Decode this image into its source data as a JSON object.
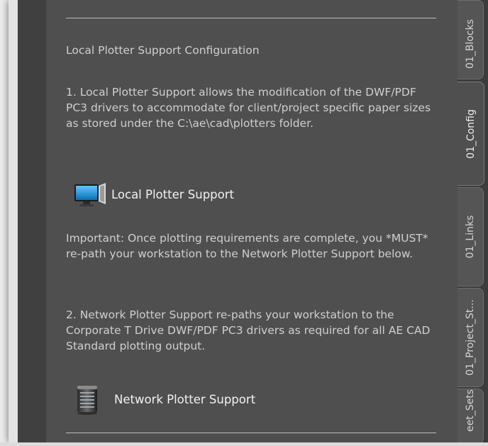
{
  "panel": {
    "title": "Local Plotter Support Configuration",
    "desc1": "1. Local Plotter Support allows the modification of the DWF/PDF PC3 drivers to accommodate for client/project specific paper sizes as stored under the C:\\ae\\cad\\plotters folder.",
    "local_link": {
      "label": "Local Plotter Support",
      "icon": "monitor-icon"
    },
    "important": "Important: Once plotting requirements are complete, you *MUST* re-path your workstation to the Network Plotter Support below.",
    "desc2": "2. Network Plotter Support re-paths your workstation to the Corporate T Drive DWF/PDF PC3 drivers as required for all AE CAD Standard plotting output.",
    "network_link": {
      "label": "Network Plotter Support",
      "icon": "server-icon"
    }
  },
  "tabs": [
    {
      "label": "01_Blocks",
      "active": false
    },
    {
      "label": "01_Config",
      "active": true
    },
    {
      "label": "01_Links",
      "active": false
    },
    {
      "label": "01_Project_St...",
      "active": false
    },
    {
      "label": "eet_Sets",
      "active": false
    }
  ],
  "colors": {
    "panel_bg": "#4f4f4f",
    "text": "#cfcfcf",
    "link_text": "#f2f2f2",
    "monitor_screen": "#1a8fd6"
  }
}
